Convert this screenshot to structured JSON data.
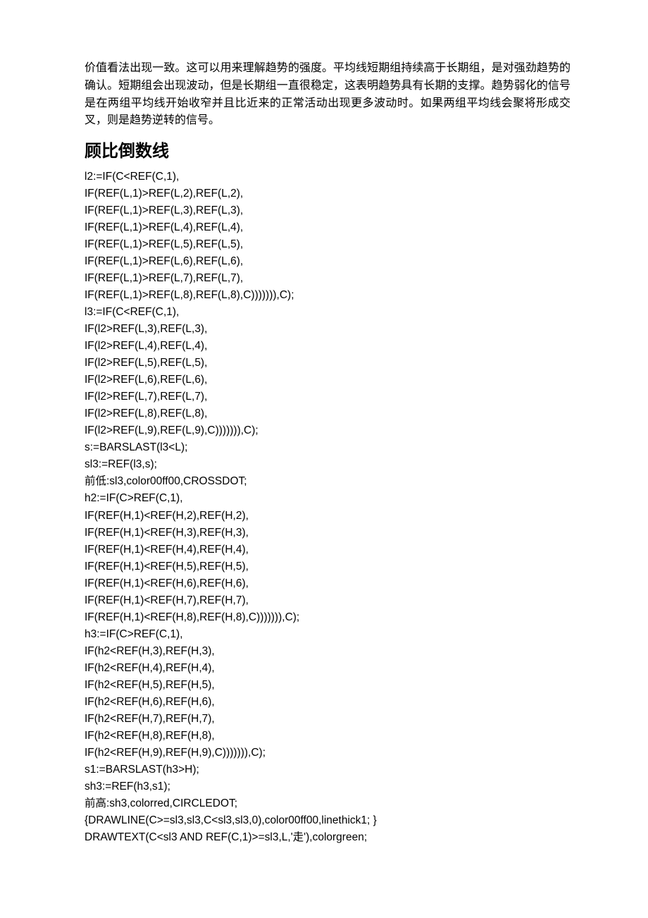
{
  "paragraphs": {
    "intro": "价值看法出现一致。这可以用来理解趋势的强度。平均线短期组持续高于长期组，是对强劲趋势的确认。短期组会出现波动，但是长期组一直很稳定，这表明趋势具有长期的支撑。趋势弱化的信号是在两组平均线开始收窄并且比近来的正常活动出现更多波动时。如果两组平均线会聚将形成交叉，则是趋势逆转的信号。"
  },
  "heading": "顾比倒数线",
  "code": [
    "l2:=IF(C<REF(C,1),",
    "IF(REF(L,1)>REF(L,2),REF(L,2),",
    "IF(REF(L,1)>REF(L,3),REF(L,3),",
    "IF(REF(L,1)>REF(L,4),REF(L,4),",
    "IF(REF(L,1)>REF(L,5),REF(L,5),",
    "IF(REF(L,1)>REF(L,6),REF(L,6),",
    "IF(REF(L,1)>REF(L,7),REF(L,7),",
    "IF(REF(L,1)>REF(L,8),REF(L,8),C))))))),C);",
    "l3:=IF(C<REF(C,1),",
    "IF(l2>REF(L,3),REF(L,3),",
    "IF(l2>REF(L,4),REF(L,4),",
    "IF(l2>REF(L,5),REF(L,5),",
    "IF(l2>REF(L,6),REF(L,6),",
    "IF(l2>REF(L,7),REF(L,7),",
    "IF(l2>REF(L,8),REF(L,8),",
    "IF(l2>REF(L,9),REF(L,9),C))))))),C);",
    "s:=BARSLAST(l3<L);",
    "sl3:=REF(l3,s);",
    "前低:sl3,color00ff00,CROSSDOT;",
    "h2:=IF(C>REF(C,1),",
    "IF(REF(H,1)<REF(H,2),REF(H,2),",
    "IF(REF(H,1)<REF(H,3),REF(H,3),",
    "IF(REF(H,1)<REF(H,4),REF(H,4),",
    "IF(REF(H,1)<REF(H,5),REF(H,5),",
    "IF(REF(H,1)<REF(H,6),REF(H,6),",
    "IF(REF(H,1)<REF(H,7),REF(H,7),",
    "IF(REF(H,1)<REF(H,8),REF(H,8),C))))))),C);",
    "h3:=IF(C>REF(C,1),",
    "IF(h2<REF(H,3),REF(H,3),",
    "IF(h2<REF(H,4),REF(H,4),",
    "IF(h2<REF(H,5),REF(H,5),",
    "IF(h2<REF(H,6),REF(H,6),",
    "IF(h2<REF(H,7),REF(H,7),",
    "IF(h2<REF(H,8),REF(H,8),",
    "IF(h2<REF(H,9),REF(H,9),C))))))),C);",
    "s1:=BARSLAST(h3>H);",
    "sh3:=REF(h3,s1);",
    "前高:sh3,colorred,CIRCLEDOT;",
    "{DRAWLINE(C>=sl3,sl3,C<sl3,sl3,0),color00ff00,linethick1; }",
    "DRAWTEXT(C<sl3 AND REF(C,1)>=sl3,L,'走'),colorgreen;"
  ]
}
